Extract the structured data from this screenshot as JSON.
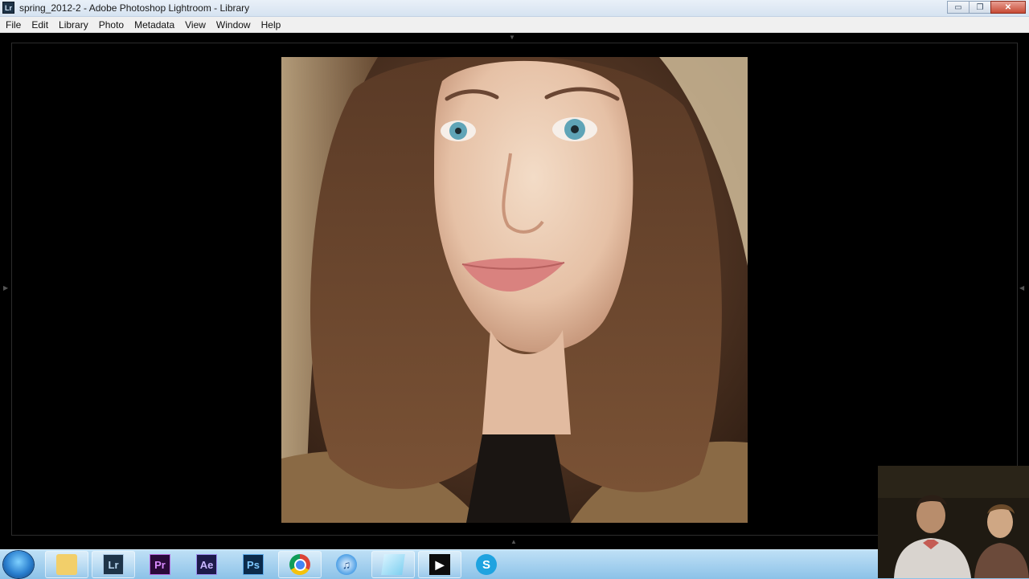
{
  "window": {
    "title": "spring_2012-2 - Adobe Photoshop Lightroom - Library",
    "app_icon": "Lr",
    "buttons": {
      "minimize": "▭",
      "maximize": "❐",
      "close": "✕"
    }
  },
  "menu": [
    "File",
    "Edit",
    "Library",
    "Photo",
    "Metadata",
    "View",
    "Window",
    "Help"
  ],
  "taskbar": {
    "apps": [
      {
        "name": "windows-explorer",
        "label": ""
      },
      {
        "name": "lightroom",
        "label": "Lr"
      },
      {
        "name": "premiere",
        "label": "Pr"
      },
      {
        "name": "after-effects",
        "label": "Ae"
      },
      {
        "name": "photoshop",
        "label": "Ps"
      },
      {
        "name": "chrome",
        "label": ""
      },
      {
        "name": "itunes",
        "label": ""
      },
      {
        "name": "notes",
        "label": ""
      },
      {
        "name": "media-player",
        "label": ""
      },
      {
        "name": "skype",
        "label": ""
      }
    ]
  },
  "colors": {
    "lr_bg": "#000000",
    "lightroom_icon": "#1e3448",
    "premiere_icon": "#2a0a3a",
    "after_effects_icon": "#1d1a4a",
    "photoshop_icon": "#0b2a4a"
  }
}
